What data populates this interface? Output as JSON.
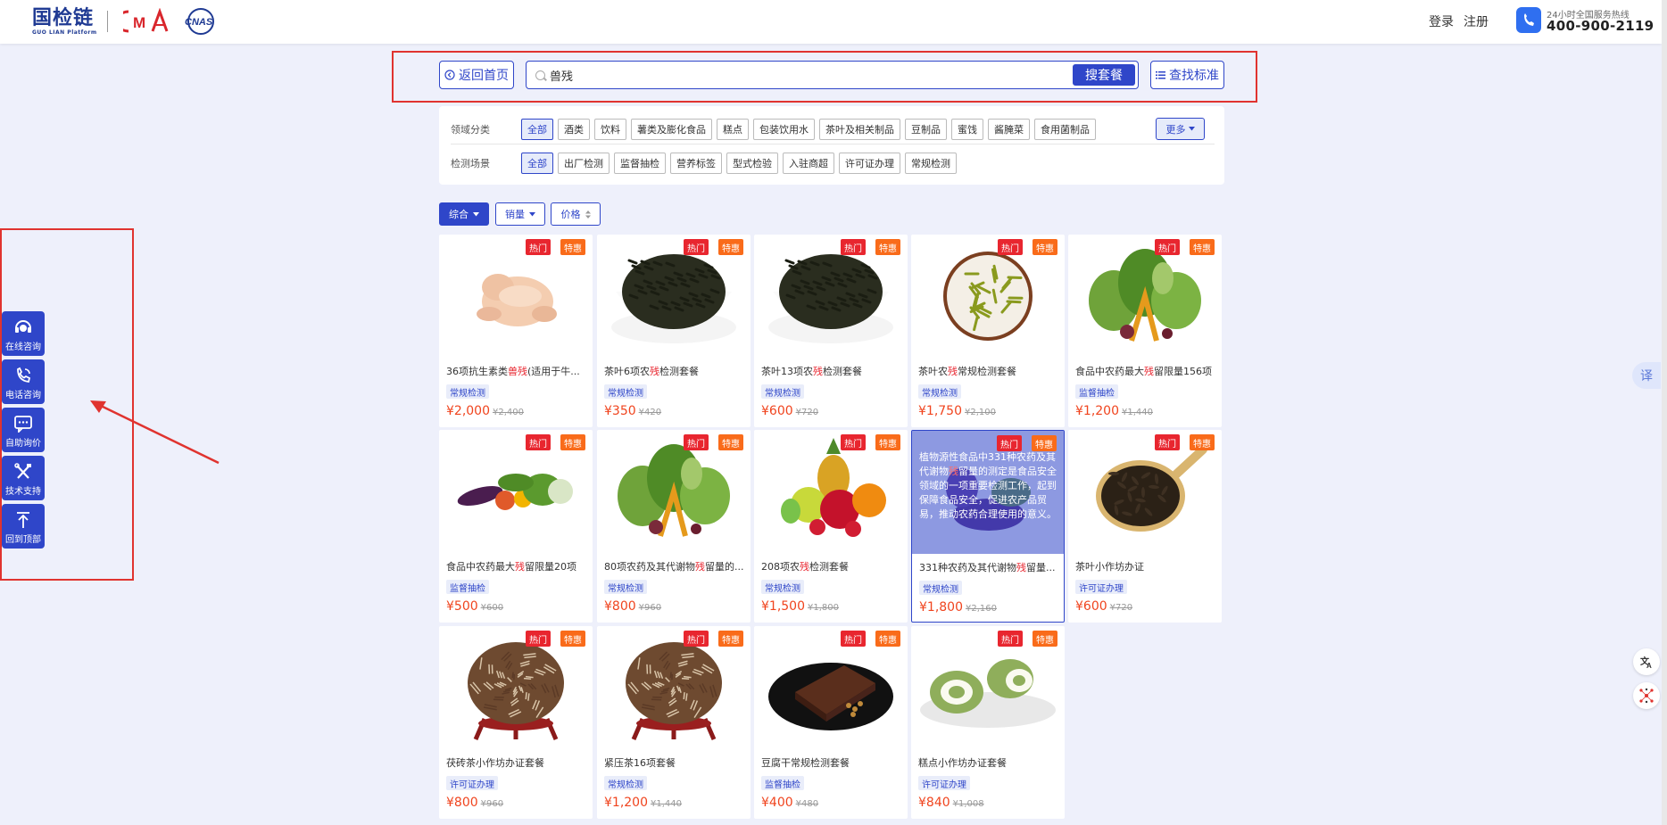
{
  "header": {
    "logo_cn": "国检链",
    "logo_en": "GUO LIAN Platform",
    "cma": "CMA",
    "cnas": "CNAS",
    "login": "登录",
    "register": "注册",
    "hotline_label": "24小时全国服务热线",
    "hotline_number": "400-900-2119"
  },
  "search": {
    "back_label": "返回首页",
    "value": "兽残",
    "button_label": "搜套餐",
    "standard_label": "查找标准"
  },
  "filters": {
    "domain_label": "领域分类",
    "domain_chips": [
      "全部",
      "酒类",
      "饮料",
      "薯类及膨化食品",
      "糕点",
      "包装饮用水",
      "茶叶及相关制品",
      "豆制品",
      "蜜饯",
      "酱腌菜",
      "食用菌制品"
    ],
    "more_label": "更多",
    "scene_label": "检测场景",
    "scene_chips": [
      "全部",
      "出厂检测",
      "监督抽检",
      "营养标签",
      "型式检验",
      "入驻商超",
      "许可证办理",
      "常规检测"
    ]
  },
  "sort": {
    "comprehensive": "综合",
    "sales": "销量",
    "price": "价格"
  },
  "badges": {
    "hot": "热门",
    "sale": "特惠"
  },
  "cards": [
    {
      "title_pre": "36项抗生素类",
      "title_hl": "兽残",
      "title_post": "(适用于牛...",
      "tag": "常规检测",
      "price": "¥2,000",
      "orig": "¥2,400"
    },
    {
      "title_pre": "茶叶6项农",
      "title_hl": "残",
      "title_post": "检测套餐",
      "tag": "常规检测",
      "price": "¥350",
      "orig": "¥420"
    },
    {
      "title_pre": "茶叶13项农",
      "title_hl": "残",
      "title_post": "检测套餐",
      "tag": "常规检测",
      "price": "¥600",
      "orig": "¥720"
    },
    {
      "title_pre": "茶叶农",
      "title_hl": "残",
      "title_post": "常规检测套餐",
      "tag": "常规检测",
      "price": "¥1,750",
      "orig": "¥2,100"
    },
    {
      "title_pre": "食品中农药最大",
      "title_hl": "残",
      "title_post": "留限量156项",
      "tag": "监督抽检",
      "price": "¥1,200",
      "orig": "¥1,440"
    },
    {
      "title_pre": "食品中农药最大",
      "title_hl": "残",
      "title_post": "留限量20项",
      "tag": "监督抽检",
      "price": "¥500",
      "orig": "¥600"
    },
    {
      "title_pre": "80项农药及其代谢物",
      "title_hl": "残",
      "title_post": "留量的...",
      "tag": "常规检测",
      "price": "¥800",
      "orig": "¥960"
    },
    {
      "title_pre": "208项农",
      "title_hl": "残",
      "title_post": "检测套餐",
      "tag": "常规检测",
      "price": "¥1,500",
      "orig": "¥1,800"
    },
    {
      "title_pre": "331种农药及其代谢物",
      "title_hl": "残",
      "title_post": "留量...",
      "tag": "常规检测",
      "price": "¥1,800",
      "orig": "¥2,160",
      "overlay_pre": "植物源性食品中331种农药及其代谢物",
      "overlay_hl": "残",
      "overlay_post": "留量的测定是食品安全领域的一项重要检测工作，起到保障食品安全，促进农产品贸易，推动农药合理使用的意义。"
    },
    {
      "title_pre": "茶叶小作坊办证",
      "title_hl": "",
      "title_post": "",
      "tag": "许可证办理",
      "price": "¥600",
      "orig": "¥720"
    },
    {
      "title_pre": "茯砖茶小作坊办证套餐",
      "title_hl": "",
      "title_post": "",
      "tag": "许可证办理",
      "price": "¥800",
      "orig": "¥960"
    },
    {
      "title_pre": "紧压茶16项套餐",
      "title_hl": "",
      "title_post": "",
      "tag": "常规检测",
      "price": "¥1,200",
      "orig": "¥1,440"
    },
    {
      "title_pre": "豆腐干常规检测套餐",
      "title_hl": "",
      "title_post": "",
      "tag": "监督抽检",
      "price": "¥400",
      "orig": "¥480"
    },
    {
      "title_pre": "糕点小作坊办证套餐",
      "title_hl": "",
      "title_post": "",
      "tag": "许可证办理",
      "price": "¥840",
      "orig": "¥1,008"
    }
  ],
  "sidebar": {
    "items": [
      {
        "label": "在线咨询",
        "icon": "headset-icon"
      },
      {
        "label": "电话咨询",
        "icon": "phone-icon"
      },
      {
        "label": "自助询价",
        "icon": "chat-icon"
      },
      {
        "label": "技术支持",
        "icon": "tools-icon"
      },
      {
        "label": "回到顶部",
        "icon": "arrow-up-icon"
      }
    ]
  },
  "right_float": {
    "translate": "译"
  },
  "colors": {
    "primary": "#2f46c9",
    "hot": "#e8262f",
    "sale": "#f96b1a",
    "price": "#f0441e",
    "annotation": "#e0332f"
  }
}
